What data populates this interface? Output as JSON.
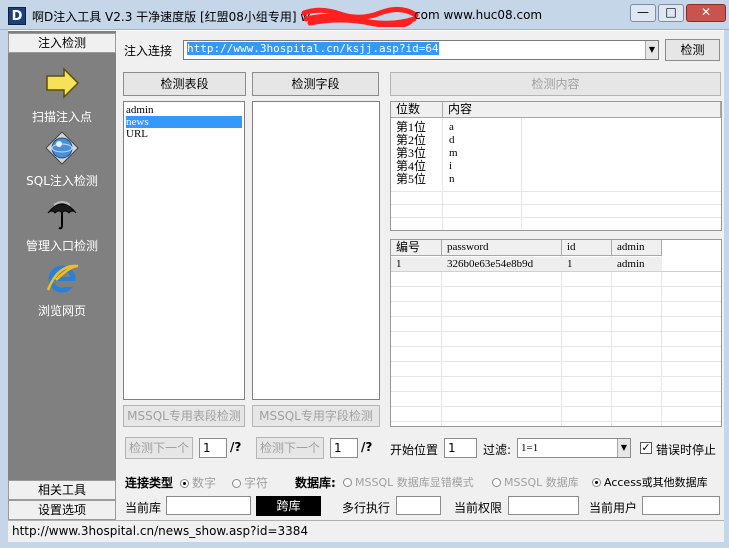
{
  "window": {
    "title_left": "啊D注入工具 V2.3 干净速度版 [红盟08小组专用] w",
    "title_right": "com  www.huc08.com",
    "controls": [
      "—",
      "□",
      "✕"
    ]
  },
  "sidebar": {
    "top_tab": "注入检测",
    "items": [
      {
        "label": "扫描注入点",
        "icon": "arrow-icon"
      },
      {
        "label": "SQL注入检测",
        "icon": "globe-target-icon"
      },
      {
        "label": "管理入口检测",
        "icon": "umbrella-icon"
      },
      {
        "label": "浏览网页",
        "icon": "ie-icon"
      }
    ],
    "bottom_tabs": [
      "相关工具",
      "设置选项"
    ]
  },
  "main": {
    "url_label": "注入连接",
    "url_value": "http://www.3hospital.cn/ksjj.asp?id=64",
    "detect_button": "检测",
    "table_button": "检测表段",
    "field_button": "检测字段",
    "content_button": "检测内容",
    "tables": [
      "admin",
      "news",
      "URL"
    ],
    "selected_table": "news",
    "position_grid": {
      "headers": [
        "位数",
        "内容"
      ],
      "rows": [
        [
          "第1位",
          "a"
        ],
        [
          "第2位",
          "d"
        ],
        [
          "第3位",
          "m"
        ],
        [
          "第4位",
          "i"
        ],
        [
          "第5位",
          "n"
        ]
      ]
    },
    "result_grid": {
      "headers": [
        "编号",
        "password",
        "id",
        "admin"
      ],
      "rows": [
        [
          "1",
          "326b0e63e54e8b9d",
          "1",
          "admin"
        ]
      ]
    },
    "mssql_table_button": "MSSQL专用表段检测",
    "mssql_field_button": "MSSQL专用字段检测",
    "next_button_1": "检测下一个",
    "next_value_1": "1",
    "next_suffix_1": "/?",
    "next_button_2": "检测下一个",
    "next_value_2": "1",
    "next_suffix_2": "/?",
    "start_label": "开始位置",
    "start_value": "1",
    "filter_label": "过滤:",
    "filter_value": "1=1",
    "stop_label": "错误时停止",
    "stop_checked": true,
    "conn_type_label": "连接类型",
    "conn_types": [
      "数字",
      "字符"
    ],
    "db_label": "数据库:",
    "db_options": [
      "MSSQL 数据库显错模式",
      "MSSQL 数据库",
      "Access或其他数据库"
    ],
    "db_selected": "Access或其他数据库",
    "current_db_label": "当前库",
    "current_db_value": "",
    "db_action_button": "跨库",
    "multi_exec_label": "多行执行",
    "multi_exec_value": "",
    "permission_label": "当前权限",
    "permission_value": "",
    "current_user_label": "当前用户",
    "current_user_value": ""
  },
  "statusbar": {
    "text": "http://www.3hospital.cn/news_show.asp?id=3384"
  },
  "colors": {
    "titlebar": "#c5d6e8",
    "sidebar": "#808080",
    "selection": "#3399ff",
    "scribble": "#ff2020"
  }
}
